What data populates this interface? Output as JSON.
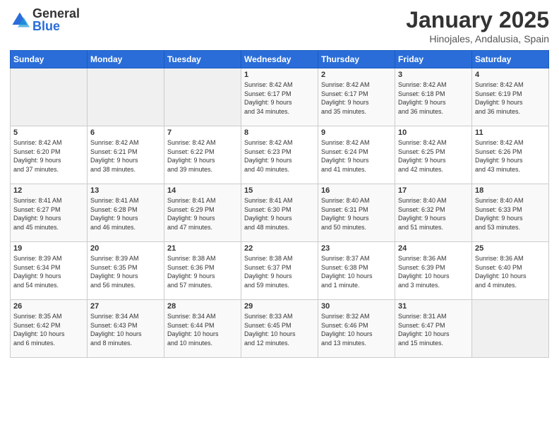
{
  "logo": {
    "general": "General",
    "blue": "Blue"
  },
  "title": "January 2025",
  "subtitle": "Hinojales, Andalusia, Spain",
  "headers": [
    "Sunday",
    "Monday",
    "Tuesday",
    "Wednesday",
    "Thursday",
    "Friday",
    "Saturday"
  ],
  "weeks": [
    [
      {
        "day": "",
        "info": ""
      },
      {
        "day": "",
        "info": ""
      },
      {
        "day": "",
        "info": ""
      },
      {
        "day": "1",
        "info": "Sunrise: 8:42 AM\nSunset: 6:17 PM\nDaylight: 9 hours\nand 34 minutes."
      },
      {
        "day": "2",
        "info": "Sunrise: 8:42 AM\nSunset: 6:17 PM\nDaylight: 9 hours\nand 35 minutes."
      },
      {
        "day": "3",
        "info": "Sunrise: 8:42 AM\nSunset: 6:18 PM\nDaylight: 9 hours\nand 36 minutes."
      },
      {
        "day": "4",
        "info": "Sunrise: 8:42 AM\nSunset: 6:19 PM\nDaylight: 9 hours\nand 36 minutes."
      }
    ],
    [
      {
        "day": "5",
        "info": "Sunrise: 8:42 AM\nSunset: 6:20 PM\nDaylight: 9 hours\nand 37 minutes."
      },
      {
        "day": "6",
        "info": "Sunrise: 8:42 AM\nSunset: 6:21 PM\nDaylight: 9 hours\nand 38 minutes."
      },
      {
        "day": "7",
        "info": "Sunrise: 8:42 AM\nSunset: 6:22 PM\nDaylight: 9 hours\nand 39 minutes."
      },
      {
        "day": "8",
        "info": "Sunrise: 8:42 AM\nSunset: 6:23 PM\nDaylight: 9 hours\nand 40 minutes."
      },
      {
        "day": "9",
        "info": "Sunrise: 8:42 AM\nSunset: 6:24 PM\nDaylight: 9 hours\nand 41 minutes."
      },
      {
        "day": "10",
        "info": "Sunrise: 8:42 AM\nSunset: 6:25 PM\nDaylight: 9 hours\nand 42 minutes."
      },
      {
        "day": "11",
        "info": "Sunrise: 8:42 AM\nSunset: 6:26 PM\nDaylight: 9 hours\nand 43 minutes."
      }
    ],
    [
      {
        "day": "12",
        "info": "Sunrise: 8:41 AM\nSunset: 6:27 PM\nDaylight: 9 hours\nand 45 minutes."
      },
      {
        "day": "13",
        "info": "Sunrise: 8:41 AM\nSunset: 6:28 PM\nDaylight: 9 hours\nand 46 minutes."
      },
      {
        "day": "14",
        "info": "Sunrise: 8:41 AM\nSunset: 6:29 PM\nDaylight: 9 hours\nand 47 minutes."
      },
      {
        "day": "15",
        "info": "Sunrise: 8:41 AM\nSunset: 6:30 PM\nDaylight: 9 hours\nand 48 minutes."
      },
      {
        "day": "16",
        "info": "Sunrise: 8:40 AM\nSunset: 6:31 PM\nDaylight: 9 hours\nand 50 minutes."
      },
      {
        "day": "17",
        "info": "Sunrise: 8:40 AM\nSunset: 6:32 PM\nDaylight: 9 hours\nand 51 minutes."
      },
      {
        "day": "18",
        "info": "Sunrise: 8:40 AM\nSunset: 6:33 PM\nDaylight: 9 hours\nand 53 minutes."
      }
    ],
    [
      {
        "day": "19",
        "info": "Sunrise: 8:39 AM\nSunset: 6:34 PM\nDaylight: 9 hours\nand 54 minutes."
      },
      {
        "day": "20",
        "info": "Sunrise: 8:39 AM\nSunset: 6:35 PM\nDaylight: 9 hours\nand 56 minutes."
      },
      {
        "day": "21",
        "info": "Sunrise: 8:38 AM\nSunset: 6:36 PM\nDaylight: 9 hours\nand 57 minutes."
      },
      {
        "day": "22",
        "info": "Sunrise: 8:38 AM\nSunset: 6:37 PM\nDaylight: 9 hours\nand 59 minutes."
      },
      {
        "day": "23",
        "info": "Sunrise: 8:37 AM\nSunset: 6:38 PM\nDaylight: 10 hours\nand 1 minute."
      },
      {
        "day": "24",
        "info": "Sunrise: 8:36 AM\nSunset: 6:39 PM\nDaylight: 10 hours\nand 3 minutes."
      },
      {
        "day": "25",
        "info": "Sunrise: 8:36 AM\nSunset: 6:40 PM\nDaylight: 10 hours\nand 4 minutes."
      }
    ],
    [
      {
        "day": "26",
        "info": "Sunrise: 8:35 AM\nSunset: 6:42 PM\nDaylight: 10 hours\nand 6 minutes."
      },
      {
        "day": "27",
        "info": "Sunrise: 8:34 AM\nSunset: 6:43 PM\nDaylight: 10 hours\nand 8 minutes."
      },
      {
        "day": "28",
        "info": "Sunrise: 8:34 AM\nSunset: 6:44 PM\nDaylight: 10 hours\nand 10 minutes."
      },
      {
        "day": "29",
        "info": "Sunrise: 8:33 AM\nSunset: 6:45 PM\nDaylight: 10 hours\nand 12 minutes."
      },
      {
        "day": "30",
        "info": "Sunrise: 8:32 AM\nSunset: 6:46 PM\nDaylight: 10 hours\nand 13 minutes."
      },
      {
        "day": "31",
        "info": "Sunrise: 8:31 AM\nSunset: 6:47 PM\nDaylight: 10 hours\nand 15 minutes."
      },
      {
        "day": "",
        "info": ""
      }
    ]
  ]
}
